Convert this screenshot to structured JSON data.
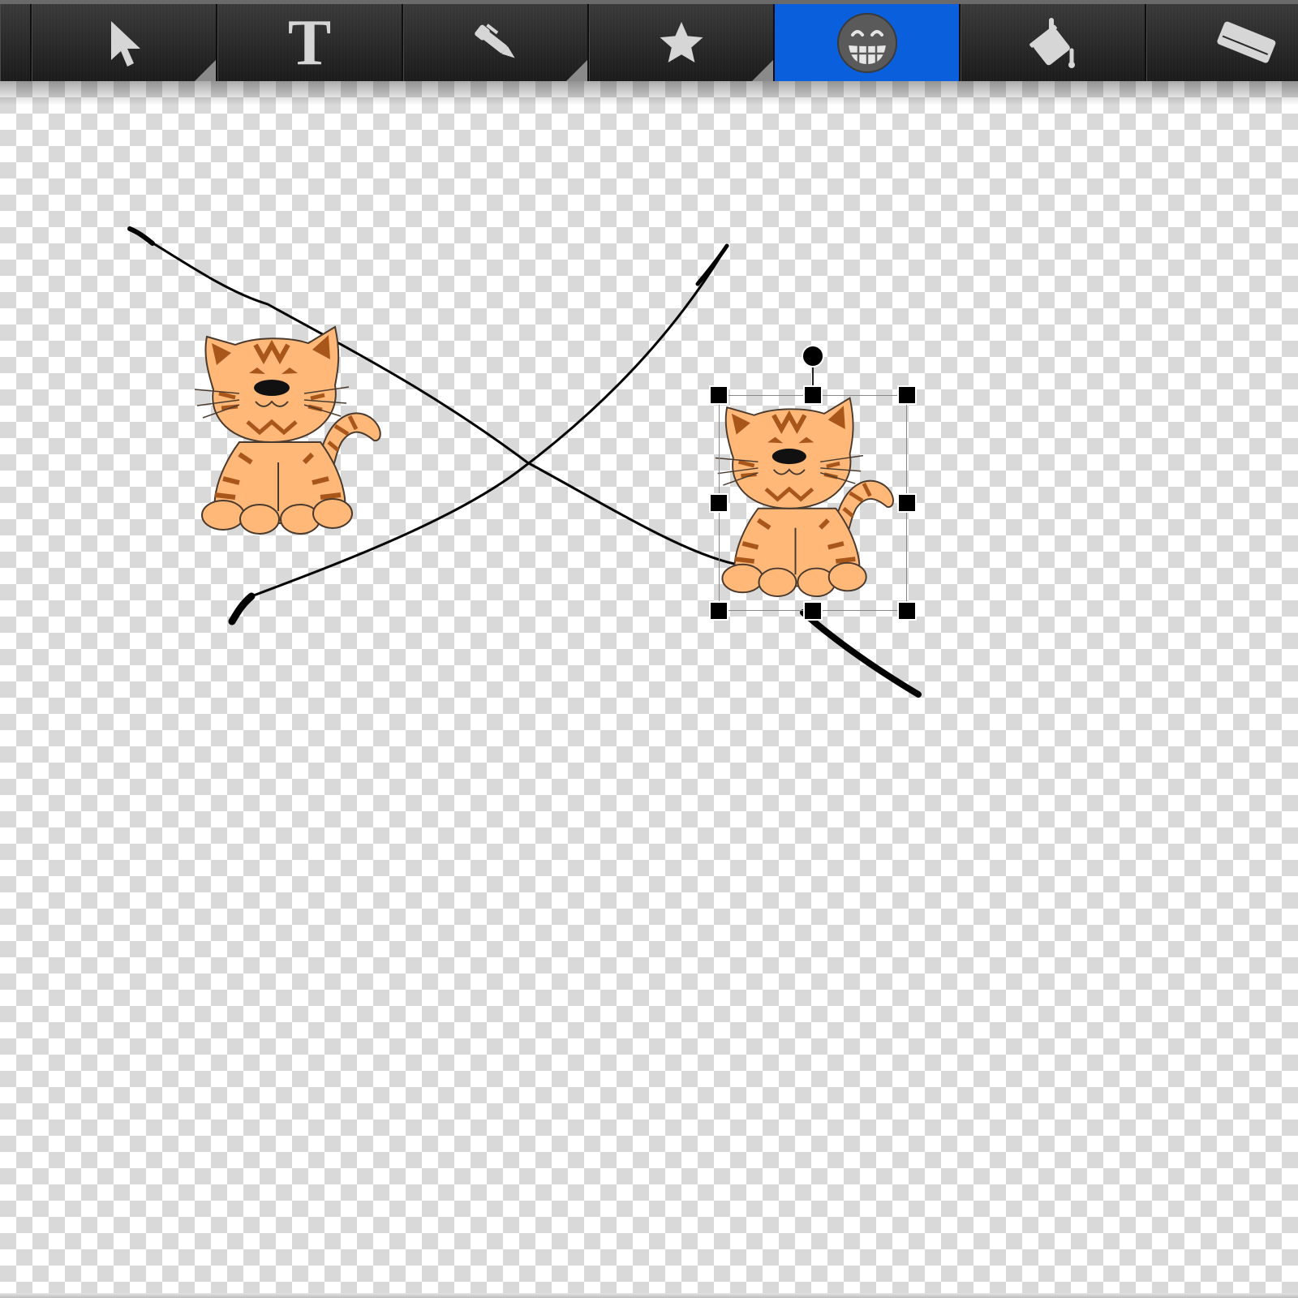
{
  "toolbar": {
    "tools": [
      {
        "id": "select",
        "icon": "arrow-pointer-icon",
        "active": false
      },
      {
        "id": "text",
        "icon": "text-t-icon",
        "glyph": "T",
        "active": false
      },
      {
        "id": "pen",
        "icon": "pen-icon",
        "active": false
      },
      {
        "id": "shape",
        "icon": "star-icon",
        "active": false
      },
      {
        "id": "sticker",
        "icon": "grin-face-icon",
        "active": true
      },
      {
        "id": "fill",
        "icon": "paint-bucket-icon",
        "active": false
      },
      {
        "id": "eraser",
        "icon": "eraser-icon",
        "active": false
      }
    ],
    "active_color": "#0a5fdc"
  },
  "canvas": {
    "background": "transparent-checkerboard",
    "checker_colors": [
      "#ffffff",
      "#d9d9d9"
    ],
    "stroke_color": "#000000",
    "stickers": [
      {
        "id": "cat-1",
        "icon": "tabby-cat-sticker",
        "selected": false
      },
      {
        "id": "cat-2",
        "icon": "tabby-cat-sticker",
        "selected": true
      }
    ]
  },
  "colors": {
    "cat_body": "#ffb878",
    "cat_stripe": "#a9561a",
    "outline": "#4a3a2e"
  }
}
